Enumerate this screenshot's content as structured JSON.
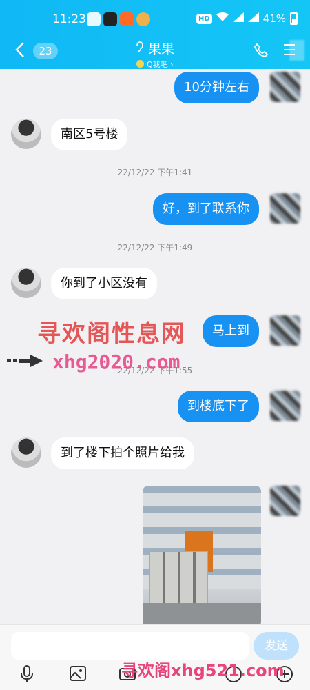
{
  "status_bar": {
    "time": "11:23",
    "battery": "41%",
    "hd_label": "HD"
  },
  "header": {
    "back_label": "<",
    "unread_count": "23",
    "title": "果果",
    "subtitle": "Q我吧",
    "title_icon": "ear-icon",
    "call_icon": "phone-icon",
    "menu_icon": "menu-icon"
  },
  "messages": [
    {
      "side": "out",
      "text": "10分钟左右"
    },
    {
      "side": "in",
      "text": "南区5号楼"
    },
    {
      "type": "timestamp",
      "text": "22/12/22 下午1:41"
    },
    {
      "side": "out",
      "text": "好，到了联系你"
    },
    {
      "type": "timestamp",
      "text": "22/12/22 下午1:49"
    },
    {
      "side": "in",
      "text": "你到了小区没有"
    },
    {
      "side": "out",
      "text": "马上到"
    },
    {
      "type": "timestamp",
      "text": "22/12/22 下午1:55"
    },
    {
      "side": "out",
      "text": "到楼底下了"
    },
    {
      "side": "in",
      "text": "到了楼下拍个照片给我"
    },
    {
      "side": "out",
      "type": "image",
      "text": ""
    }
  ],
  "watermarks": {
    "site_name": "寻欢阁性息网",
    "site_url": "xhg2020.com",
    "bottom": "寻欢阁xhg521.com"
  },
  "input": {
    "placeholder": "",
    "send_label": "发送"
  },
  "toolbar": {
    "icons": [
      "mic-icon",
      "image-icon",
      "camera-icon",
      "emoji-icon",
      "plus-icon"
    ]
  },
  "colors": {
    "header": "#14c0f5",
    "outgoing_bubble": "#1892f2",
    "incoming_bubble": "#ffffff",
    "send_button": "#bfe1fb"
  }
}
